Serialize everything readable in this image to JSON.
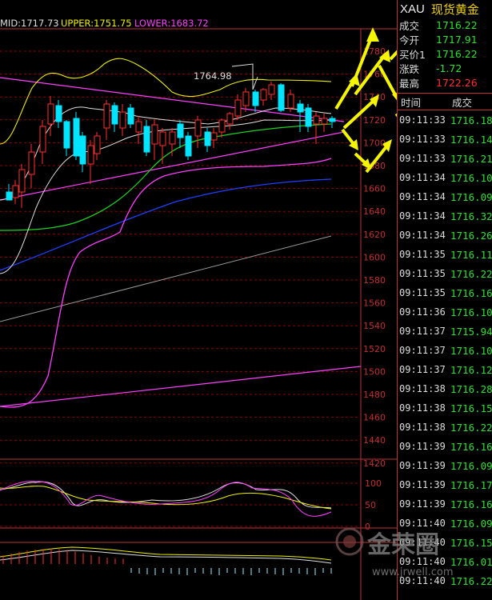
{
  "indicator": {
    "mid": "MID:1717.73",
    "upper": "UPPER:1751.75",
    "lower": "LOWER:1683.72"
  },
  "high_label": "1764.98",
  "price_axis": [
    "1780",
    "1760",
    "1740",
    "1720",
    "1700",
    "1680",
    "1660",
    "1640",
    "1620",
    "1600",
    "1580",
    "1560",
    "1540",
    "1520",
    "1500",
    "1480",
    "1460",
    "1440",
    "1420"
  ],
  "osc_axis": [
    "100",
    "50",
    "0"
  ],
  "colors": {
    "up": "#ff3030",
    "down": "#00e5ff",
    "tick_price": "#2ee02e",
    "arrow": "#f5f500",
    "grid": "#8b0000"
  },
  "quote": {
    "symbol": "XAU",
    "name": "现货黄金",
    "rows": [
      {
        "k": "成交",
        "v": "1716.22",
        "c": "#2ee02e"
      },
      {
        "k": "今开",
        "v": "1717.91",
        "c": "#2ee02e"
      },
      {
        "k": "买价1",
        "v": "1716.22",
        "c": "#2ee02e"
      },
      {
        "k": "涨跌",
        "v": "-1.72",
        "c": "#2ee02e"
      },
      {
        "k": "最高",
        "v": "1722.26",
        "c": "#ff3030"
      }
    ]
  },
  "ticks_header": {
    "time": "时间",
    "price": "成交"
  },
  "ticks": [
    {
      "t": "09:11:33",
      "p": "1716.18"
    },
    {
      "t": "09:11:33",
      "p": "1716.14"
    },
    {
      "t": "09:11:33",
      "p": "1716.21"
    },
    {
      "t": "09:11:34",
      "p": "1716.10"
    },
    {
      "t": "09:11:34",
      "p": "1716.09"
    },
    {
      "t": "09:11:34",
      "p": "1716.32"
    },
    {
      "t": "09:11:34",
      "p": "1716.26"
    },
    {
      "t": "09:11:35",
      "p": "1716.11"
    },
    {
      "t": "09:11:35",
      "p": "1716.22"
    },
    {
      "t": "09:11:35",
      "p": "1716.16"
    },
    {
      "t": "09:11:36",
      "p": "1716.10"
    },
    {
      "t": "09:11:37",
      "p": "1715.94"
    },
    {
      "t": "09:11:37",
      "p": "1716.10"
    },
    {
      "t": "09:11:37",
      "p": "1716.12"
    },
    {
      "t": "09:11:38",
      "p": "1716.28"
    },
    {
      "t": "09:11:38",
      "p": "1716.15"
    },
    {
      "t": "09:11:38",
      "p": "1716.22"
    },
    {
      "t": "09:11:39",
      "p": "1716.16"
    },
    {
      "t": "09:11:39",
      "p": "1716.09"
    },
    {
      "t": "09:11:39",
      "p": "1716.17"
    },
    {
      "t": "09:11:39",
      "p": "1716.16"
    },
    {
      "t": "09:11:40",
      "p": "1716.09"
    },
    {
      "t": "09:11:40",
      "p": "1716.15"
    },
    {
      "t": "09:11:40",
      "p": "1716.01"
    },
    {
      "t": "09:11:40",
      "p": "1716.22"
    }
  ],
  "watermark": {
    "brand": "金荣圈",
    "url": "www.jrwell.com"
  }
}
